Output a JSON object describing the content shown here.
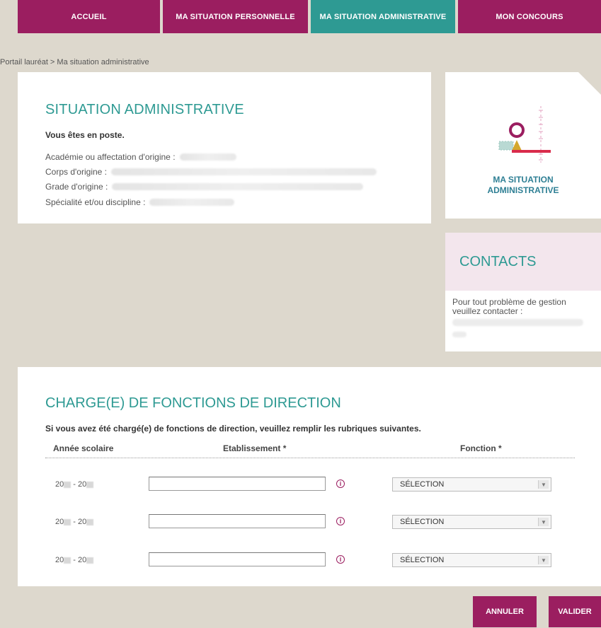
{
  "nav": {
    "tabs": [
      {
        "label": "ACCUEIL"
      },
      {
        "label": "MA SITUATION PERSONNELLE"
      },
      {
        "label": "MA SITUATION ADMINISTRATIVE"
      },
      {
        "label": "MON CONCOURS"
      }
    ],
    "active_tab": "MA SITUATION ADMINISTRATIVE"
  },
  "breadcrumb": {
    "root": "Portail lauréat",
    "separator": " > ",
    "current": "Ma situation administrative"
  },
  "situation": {
    "title": "SITUATION ADMINISTRATIVE",
    "status": "Vous êtes en poste.",
    "rows": [
      {
        "label": "Académie ou affectation d'origine :"
      },
      {
        "label": "Corps d'origine :"
      },
      {
        "label": "Grade d'origine :"
      },
      {
        "label": "Spécialité et/ou discipline :"
      }
    ]
  },
  "side_panel": {
    "label_line1": "MA SITUATION",
    "label_line2": "ADMINISTRATIVE",
    "icon": "person-chart-icon"
  },
  "contacts": {
    "title": "CONTACTS",
    "text": "Pour tout problème de gestion veuillez contacter :"
  },
  "direction": {
    "title": "CHARGE(E) DE FONCTIONS DE DIRECTION",
    "instructions": "Si vous avez été chargé(e) de fonctions de direction, veuillez remplir les rubriques suivantes.",
    "columns": {
      "year": "Année scolaire",
      "etablissement": "Etablissement *",
      "fonction": "Fonction *"
    },
    "rows": [
      {
        "year_prefix_a": "20",
        "year_sep": " - ",
        "year_prefix_b": "20",
        "etablissement_value": "",
        "fonction_value": "SÉLECTION"
      },
      {
        "year_prefix_a": "20",
        "year_sep": " - ",
        "year_prefix_b": "20",
        "etablissement_value": "",
        "fonction_value": "SÉLECTION"
      },
      {
        "year_prefix_a": "20",
        "year_sep": " - ",
        "year_prefix_b": "20",
        "etablissement_value": "",
        "fonction_value": "SÉLECTION"
      }
    ]
  },
  "actions": {
    "cancel_label": "ANNULER",
    "submit_label": "VALIDER"
  },
  "colors": {
    "brand": "#9b1e60",
    "accent": "#2e9a93",
    "background": "#ddd8cd"
  }
}
